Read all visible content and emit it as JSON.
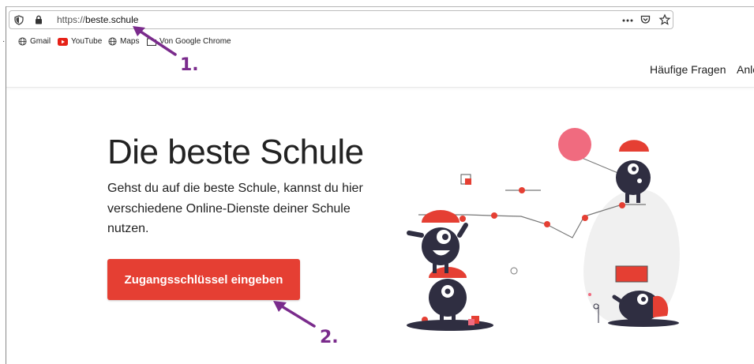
{
  "browser": {
    "url_prefix": "https://",
    "url_host": "beste.schule",
    "bookmarks": [
      {
        "label": "Gmail",
        "icon": "globe-icon"
      },
      {
        "label": "YouTube",
        "icon": "youtube-icon"
      },
      {
        "label": "Maps",
        "icon": "globe-icon"
      },
      {
        "label": "Von Google Chrome",
        "icon": "folder-icon"
      }
    ]
  },
  "nav": {
    "faq": "Häufige Fragen",
    "cut": "Anle"
  },
  "hero": {
    "title": "Die beste Schule",
    "text": "Gehst du auf die beste Schule, kannst du hier verschiedene Online-Dienste deiner Schule nutzen.",
    "cta": "Zugangsschlüssel eingeben"
  },
  "annotations": {
    "one": "1.",
    "two": "2."
  },
  "colors": {
    "accent": "#e53f33",
    "annotation": "#7a2b8c"
  }
}
